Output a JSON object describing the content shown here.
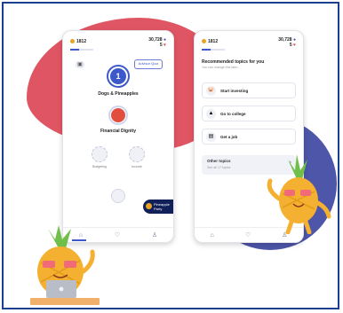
{
  "phone_left": {
    "status": {
      "coins": "1812",
      "gems": "30,728",
      "hearts": "5"
    },
    "advisor_badge": "Advisor Quiz",
    "unit_number": "1",
    "node_1_label": "Dogs & Pineapples",
    "node_2_label": "Financial Dignity",
    "sub_left_label": "Budgeting",
    "sub_right_label": "Income",
    "tooltip": {
      "line1": "Pineapple",
      "line2": "Party"
    }
  },
  "phone_right": {
    "status": {
      "coins": "1812",
      "gems": "30,728",
      "hearts": "5"
    },
    "title": "Recommended topics for you",
    "subtitle": "You can change this later...",
    "topics": [
      {
        "label": "Start investing",
        "icon": "piggy-bank-icon"
      },
      {
        "label": "Go to college",
        "icon": "graduation-cap-icon"
      },
      {
        "label": "Get a job",
        "icon": "briefcase-icon"
      }
    ],
    "other_title": "Other topics",
    "other_sub": "See all 17 topics"
  },
  "colors": {
    "accent": "#3d58c9",
    "blob_red": "#e05563",
    "blob_blue": "#4d56a8",
    "border": "#1b3f8f"
  }
}
